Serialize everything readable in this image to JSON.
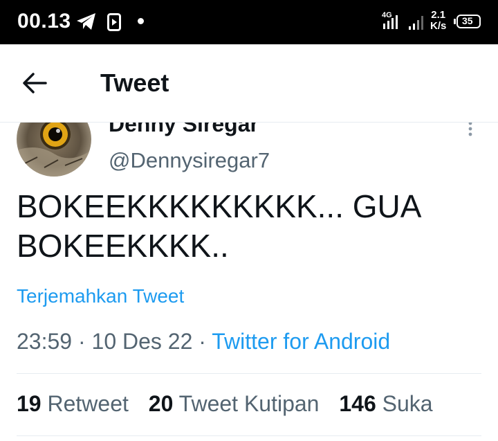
{
  "status_bar": {
    "time": "00.13",
    "network": "4G",
    "speed_value": "2.1",
    "speed_unit": "K/s",
    "battery": "35"
  },
  "header": {
    "title": "Tweet",
    "back_icon": "arrow-left-icon"
  },
  "tweet": {
    "author_name": "Denny Siregar",
    "author_handle": "@Dennysiregar7",
    "text_line1": "BOKEEKKKKKKKKK... GUA",
    "text_line2": "BOKEEKKKK..",
    "translate_label": "Terjemahkan Tweet",
    "time": "23:59",
    "date": "10 Des 22",
    "separator": "·",
    "source": "Twitter for Android",
    "retweets": {
      "count": "19",
      "label": "Retweet"
    },
    "quote_tweets": {
      "count": "20",
      "label": "Tweet Kutipan"
    },
    "likes": {
      "count": "146",
      "label": "Suka"
    }
  },
  "colors": {
    "link": "#1d9bf0",
    "text": "#0f1419",
    "secondary": "#536471",
    "statusbar": "#000000"
  }
}
